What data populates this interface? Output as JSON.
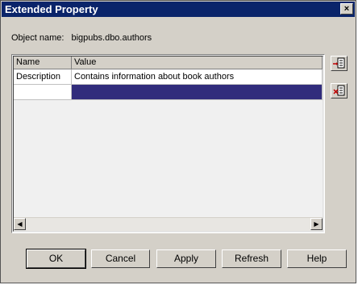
{
  "window": {
    "title": "Extended Property",
    "close_glyph": "×"
  },
  "object": {
    "label": "Object name:",
    "value": "bigpubs.dbo.authors"
  },
  "grid": {
    "columns": [
      "Name",
      "Value"
    ],
    "rows": [
      {
        "name": "Description",
        "value": "Contains information about book authors"
      },
      {
        "name": "",
        "value": ""
      }
    ],
    "selected_color": "#312c7c"
  },
  "side_buttons": [
    {
      "icon": "add-property-icon"
    },
    {
      "icon": "delete-property-icon"
    }
  ],
  "buttons": {
    "ok": "OK",
    "cancel": "Cancel",
    "apply": "Apply",
    "refresh": "Refresh",
    "help": "Help"
  }
}
